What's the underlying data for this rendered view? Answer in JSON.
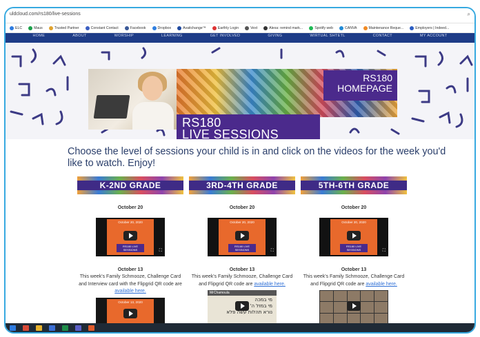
{
  "browser": {
    "url": "uldcloud.com/rs180/live-sessions",
    "bookmarks": [
      {
        "label": "ELC",
        "color": "#2d7be0"
      },
      {
        "label": "Maus",
        "color": "#1aa04a"
      },
      {
        "label": "Trusted Partner",
        "color": "#e0a22d"
      },
      {
        "label": "Constant Contact",
        "color": "#3b5fc2"
      },
      {
        "label": "Facebook",
        "color": "#3b5998"
      },
      {
        "label": "Dropbox",
        "color": "#2f7fe0"
      },
      {
        "label": "Avaitchange™",
        "color": "#1f4aa0"
      },
      {
        "label": "Earthly Login",
        "color": "#d33"
      },
      {
        "label": "Vext",
        "color": "#555"
      },
      {
        "label": "Alexa: remind mark...",
        "color": "#333"
      },
      {
        "label": "Spotify web",
        "color": "#1db954"
      },
      {
        "label": "CANVA",
        "color": "#1f8ad6"
      },
      {
        "label": "Maintenance Reque...",
        "color": "#f08a24"
      },
      {
        "label": "Employers | Indeed...",
        "color": "#2a5cc2"
      }
    ]
  },
  "nav": [
    "HOME",
    "ABOUT",
    "WORSHIP",
    "LEARNING",
    "GET INVOLVED",
    "GIVING",
    "WIRTUAL SHTETL",
    "CONTACT",
    "MY ACCOUNT"
  ],
  "hero": {
    "live_line1": "RS180",
    "live_line2": "LIVE SESSIONS",
    "home_line1": "RS180",
    "home_line2": "HOMEPAGE"
  },
  "intro": "Choose the level of sessions your child is in and click on the videos for the week you'd like to watch. Enjoy!",
  "grades": [
    {
      "banner": "K-2ND GRADE",
      "date1": "October 20",
      "video1_label": "October 20, 2020",
      "video1_badge": "RS180 LIVE SESSIONS",
      "date2": "October 13",
      "desc": "This week's Family Schmooze, Challenge Card and Interview card with the Flipgrid QR code are ",
      "link": "available here.",
      "video2_label": "October 13, 2020"
    },
    {
      "banner": "3RD-4TH GRADE",
      "date1": "October 20",
      "video1_label": "October 20, 2020",
      "video1_badge": "RS180 LIVE SESSIONS",
      "date2": "October 13",
      "desc": "This week's Family Schmooze, Challenge Card and Flipgrid QR code are ",
      "link": "available here.",
      "video2_header": "MrChamoula",
      "video2_text": "מי במכה\nמי במזל ה' בקודש\nנורא תהלות עשה פלא"
    },
    {
      "banner": "5TH-6TH GRADE",
      "date1": "October 20",
      "video1_label": "October 20, 2020",
      "video1_badge": "RS180 LIVE SESSIONS",
      "date2": "October 13",
      "desc": "This week's Family Schmooze, Challenge Card and Flipgrid QR code are ",
      "link": "available here."
    }
  ]
}
